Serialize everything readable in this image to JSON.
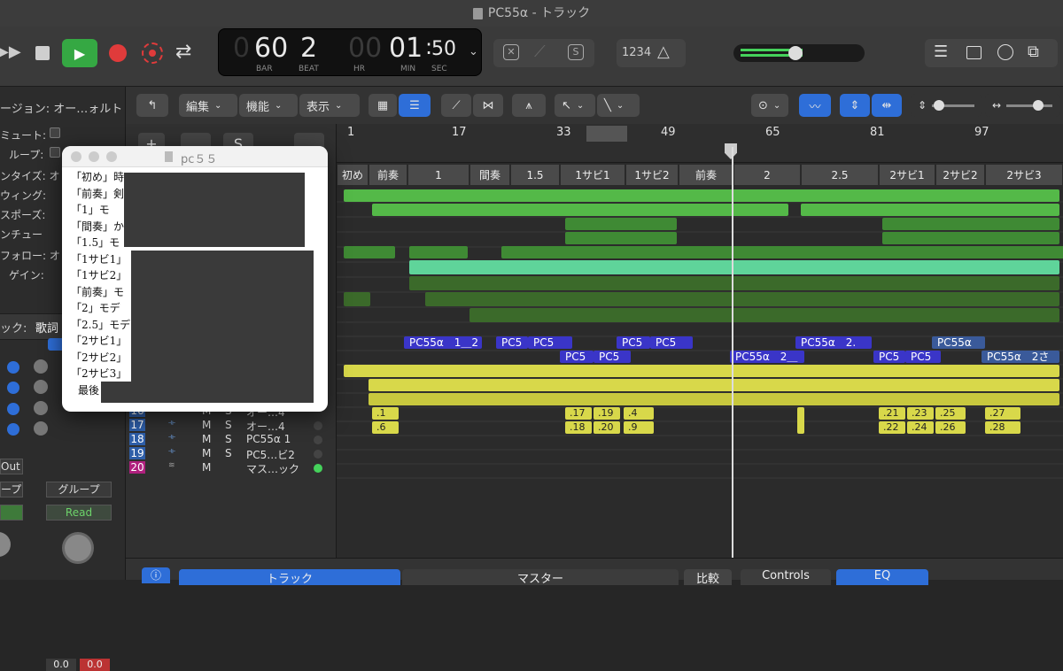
{
  "window": {
    "title": "PC55α - トラック"
  },
  "lcd": {
    "bar": "60",
    "beat": "2",
    "hr": "00",
    "min": "01",
    "sec": "50",
    "bar_label": "BAR",
    "beat_label": "BEAT",
    "hr_label": "HR",
    "min_label": "MIN",
    "sec_label": "SEC"
  },
  "controlbar": {
    "count_in": "1234"
  },
  "toolbar": {
    "edit": "編集",
    "functions": "機能",
    "view": "表示"
  },
  "inspector": {
    "region": "ージョン: オー…ォルト",
    "mute": "ミュート:",
    "loop": "ループ:",
    "quantize": "ンタイズ: オ",
    "swing": "ウィング:",
    "transpose": "スポーズ:",
    "fine_tune": "ンチュー",
    "follow": "フォロー: オ",
    "gain": "ゲイン:",
    "track": "ック:",
    "track_value": "歌詞",
    "out": "Out",
    "group_left": "ープ",
    "group_right": "グループ",
    "read": "Read",
    "vol_left": "0.0",
    "vol_right": "0.0"
  },
  "ruler": {
    "bars": [
      "1",
      "17",
      "33",
      "49",
      "65",
      "81",
      "97"
    ]
  },
  "markers": [
    "初め",
    "前奏",
    "1",
    "間奏",
    "1.5",
    "1サビ1",
    "1サビ2",
    "前奏",
    "2",
    "2.5",
    "2サビ1",
    "2サビ2",
    "2サビ3"
  ],
  "tracks": [
    {
      "num": "16",
      "name": "オー…4"
    },
    {
      "num": "17",
      "name": "オー…4"
    },
    {
      "num": "18",
      "name": "PC55α 1"
    },
    {
      "num": "19",
      "name": "PC5…ビ2"
    },
    {
      "num": "20",
      "name": "マス…ック"
    }
  ],
  "track_buttons": {
    "m": "M",
    "s": "S"
  },
  "regions": {
    "blue1": [
      "PC55α　1＿2",
      "PC5",
      "PC5",
      "PC5",
      "PC5",
      "PC55α　2.",
      "PC55α"
    ],
    "blue2": [
      "PC5",
      "PC5",
      "PC55α　2＿",
      "PC5",
      "PC5",
      "PC55α　2さ"
    ],
    "yellow1": [
      ".1",
      ".17",
      ".19",
      ".4",
      ".21",
      ".23",
      ".25",
      ".27"
    ],
    "yellow2": [
      ".6",
      ".18",
      ".20",
      ".9",
      ".22",
      ".24",
      ".26",
      ".28"
    ]
  },
  "notepad": {
    "title": "pc５５",
    "lines": [
      "「初め」時",
      "「前奏」剣",
      "「1」モ",
      "「間奏」か",
      "「1.5」モ",
      "「1サビ1」",
      "「1サビ2」",
      "「前奏」モ",
      "「2」モデ",
      "「2.5」モデ",
      "「2サビ1」",
      "「2サビ2」",
      "「2サビ3」",
      "最後"
    ]
  },
  "bottom": {
    "track": "トラック",
    "master": "マスター",
    "compare": "比較",
    "controls": "Controls",
    "eq": "EQ"
  },
  "colors": {
    "green": "#54b948",
    "light_green": "#5fd49a",
    "dark_green": "#3b6a2a",
    "blue": "#3a35c8",
    "yellow": "#d8d84a",
    "play": "#35a843",
    "record": "#e03b3b"
  }
}
